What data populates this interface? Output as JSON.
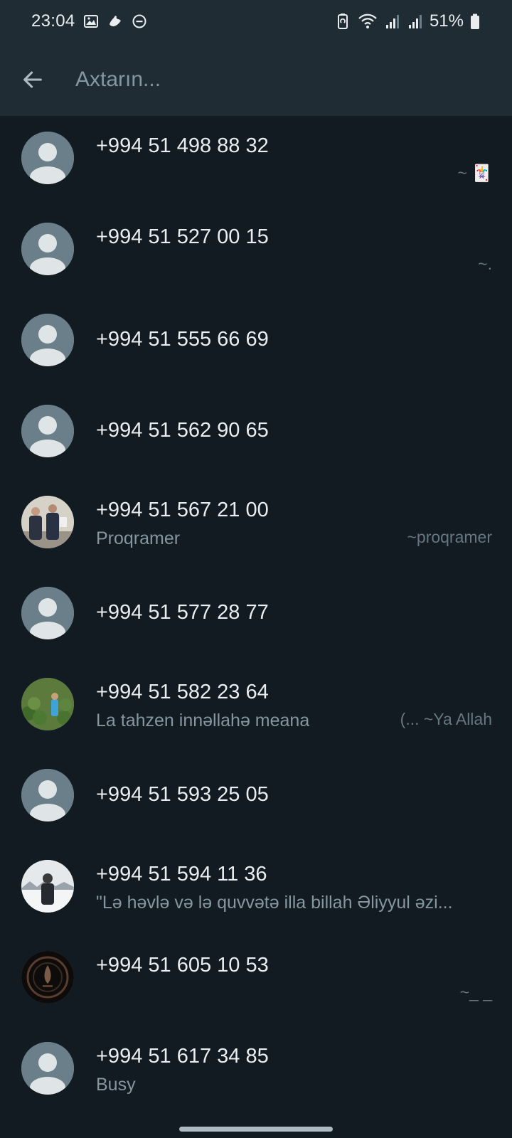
{
  "status_bar": {
    "time": "23:04",
    "battery_percent": "51%",
    "icons": [
      "gallery-icon",
      "hand-wave-icon",
      "do-not-disturb-icon",
      "battery-saver-icon",
      "wifi-icon",
      "signal-icon",
      "signal-icon",
      "battery-icon"
    ]
  },
  "search": {
    "placeholder": "Axtarın...",
    "value": ""
  },
  "contacts": [
    {
      "number": "+994 51 498 88 32",
      "status": "",
      "pushname": "~ 🃏",
      "avatar": "default"
    },
    {
      "number": "+994 51 527 00 15",
      "status": "",
      "pushname": "~.",
      "avatar": "default"
    },
    {
      "number": "+994 51 555 66 69",
      "status": "",
      "pushname": "",
      "avatar": "default"
    },
    {
      "number": "+994 51 562 90 65",
      "status": "",
      "pushname": "",
      "avatar": "default"
    },
    {
      "number": "+994 51 567 21 00",
      "status": "Proqramer",
      "pushname": "~proqramer",
      "avatar": "photo-two-men"
    },
    {
      "number": "+994 51 577 28 77",
      "status": "",
      "pushname": "",
      "avatar": "default"
    },
    {
      "number": "+994 51 582 23 64",
      "status": "La tahzen innəllahə meana",
      "pushname": "(... ~Ya Allah",
      "avatar": "photo-watermelons"
    },
    {
      "number": "+994 51 593 25 05",
      "status": "",
      "pushname": "",
      "avatar": "default"
    },
    {
      "number": "+994 51 594 11 36",
      "status": "\"Lə həvlə və lə quvvətə illa billah Əliyyul əzi...",
      "pushname": "",
      "avatar": "photo-man-snow"
    },
    {
      "number": "+994 51 605 10 53",
      "status": "",
      "pushname": "~_ _",
      "avatar": "photo-emblem"
    },
    {
      "number": "+994 51 617 34 85",
      "status": "Busy",
      "pushname": "",
      "avatar": "default"
    }
  ],
  "colors": {
    "background": "#111b21",
    "header": "#1f2c34",
    "primary_text": "#e9edef",
    "secondary_text": "#8696a0",
    "avatar_default": "#6a7f8a"
  }
}
